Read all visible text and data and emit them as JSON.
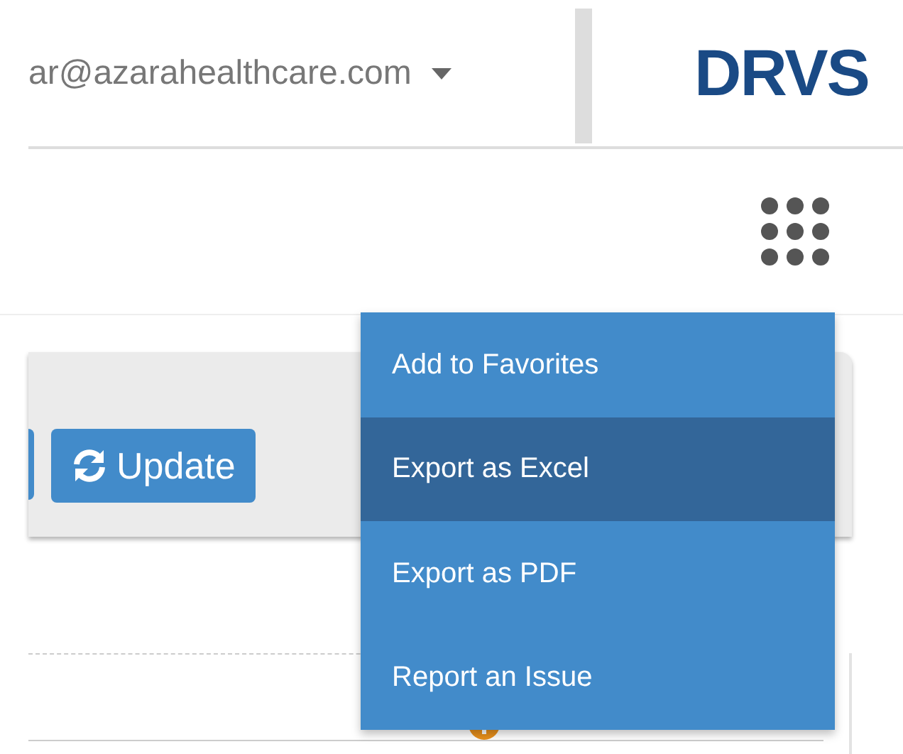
{
  "header": {
    "user_email": "ar@azarahealthcare.com",
    "logo": "DRVS"
  },
  "toolbar": {
    "buttons": [
      {
        "kind": "partial"
      },
      {
        "kind": "icon-text",
        "label": "Update"
      }
    ]
  },
  "menu": {
    "items": [
      {
        "label": "Add to Favorites",
        "selected": false
      },
      {
        "label": "Export as Excel",
        "selected": true
      },
      {
        "label": "Export as PDF",
        "selected": false
      },
      {
        "label": "Report an Issue",
        "selected": false
      }
    ]
  }
}
